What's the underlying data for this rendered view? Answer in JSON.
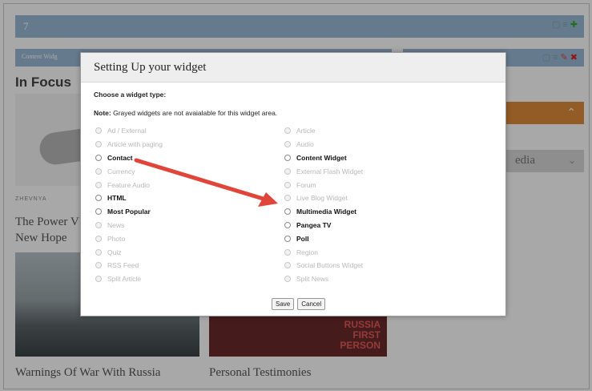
{
  "background": {
    "topbar_number": "7",
    "content_bar_label": "Content Widg",
    "section_title": "In Focus",
    "small_caption": "ZHEVNYA",
    "power_title_lines": [
      "The Power V",
      "New Hope"
    ],
    "photo_overlay_lines": [
      "RUSSIA",
      "FIRST",
      "PERSON"
    ],
    "caption_left": "Warnings Of War With Russia",
    "caption_right": "Personal Testimonies",
    "right_panel_text": "edia"
  },
  "dialog": {
    "title": "Setting Up your widget",
    "choose_label": "Choose a widget type:",
    "note_bold": "Note:",
    "note_text": " Grayed widgets are not avaialable for this widget area.",
    "left_options": [
      {
        "label": "Ad / External",
        "enabled": false
      },
      {
        "label": "Article with paging",
        "enabled": false
      },
      {
        "label": "Contact",
        "enabled": true
      },
      {
        "label": "Currency",
        "enabled": false
      },
      {
        "label": "Feature Audio",
        "enabled": false
      },
      {
        "label": "HTML",
        "enabled": true
      },
      {
        "label": "Most Popular",
        "enabled": true
      },
      {
        "label": "News",
        "enabled": false
      },
      {
        "label": "Photo",
        "enabled": false
      },
      {
        "label": "Quiz",
        "enabled": false
      },
      {
        "label": "RSS Feed",
        "enabled": false
      },
      {
        "label": "Split Article",
        "enabled": false
      }
    ],
    "right_options": [
      {
        "label": "Article",
        "enabled": false
      },
      {
        "label": "Audio",
        "enabled": false
      },
      {
        "label": "Content Widget",
        "enabled": true
      },
      {
        "label": "External Flash Widget",
        "enabled": false
      },
      {
        "label": "Forum",
        "enabled": false
      },
      {
        "label": "Live Blog Widget",
        "enabled": false
      },
      {
        "label": "Multimedia Widget",
        "enabled": true,
        "selected": true
      },
      {
        "label": "Pangea TV",
        "enabled": true
      },
      {
        "label": "Poll",
        "enabled": true
      },
      {
        "label": "Region",
        "enabled": false
      },
      {
        "label": "Social Buttons Widget",
        "enabled": false
      },
      {
        "label": "Split News",
        "enabled": false
      }
    ],
    "save_label": "Save",
    "cancel_label": "Cancel"
  },
  "colors": {
    "header_bar": "#9cbad6",
    "accent_orange": "#e08a3a",
    "arrow_red": "#e0453a"
  }
}
